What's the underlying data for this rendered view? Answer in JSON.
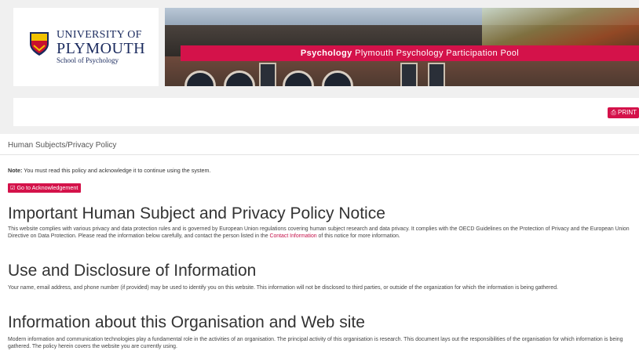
{
  "logo": {
    "line1": "UNIVERSITY OF",
    "line2": "PLYMOUTH",
    "line3": "School of Psychology"
  },
  "banner": {
    "bold": "Psychology",
    "rest": " Plymouth Psychology Participation Pool"
  },
  "toolbar": {
    "print_label": "PRINT"
  },
  "page": {
    "breadcrumb": "Human Subjects/Privacy Policy",
    "note_label": "Note:",
    "note_text": " You must read this policy and acknowledge it to continue using the system.",
    "ack_button": "Go to Acknowledgement",
    "section1_title": "Important Human Subject and Privacy Policy Notice",
    "section1_text_a": "This website complies with various privacy and data protection rules and is governed by European Union regulations covering human subject research and data privacy. It complies with the OECD Guidelines on the Protection of Privacy and the European Union Directive on Data Protection. Please read the information below carefully, and contact the person listed in the ",
    "section1_link": "Contact Information",
    "section1_text_b": " of this notice for more information.",
    "section2_title": "Use and Disclosure of Information",
    "section2_text": "Your name, email address, and phone number (if provided) may be used to identify you on this website. This information will not be disclosed to third parties, or outside of the organization for which the information is being gathered.",
    "section3_title": "Information about this Organisation and Web site",
    "section3_text": "Modern information and communication technologies play a fundamental role in the activities of an organisation. The principal activity of this organisation is research. This document lays out the responsibilities of the organisation for which information is being gathered. The policy herein covers the website you are currently using."
  },
  "colors": {
    "accent": "#d4124a",
    "navy": "#1a2a5e"
  }
}
